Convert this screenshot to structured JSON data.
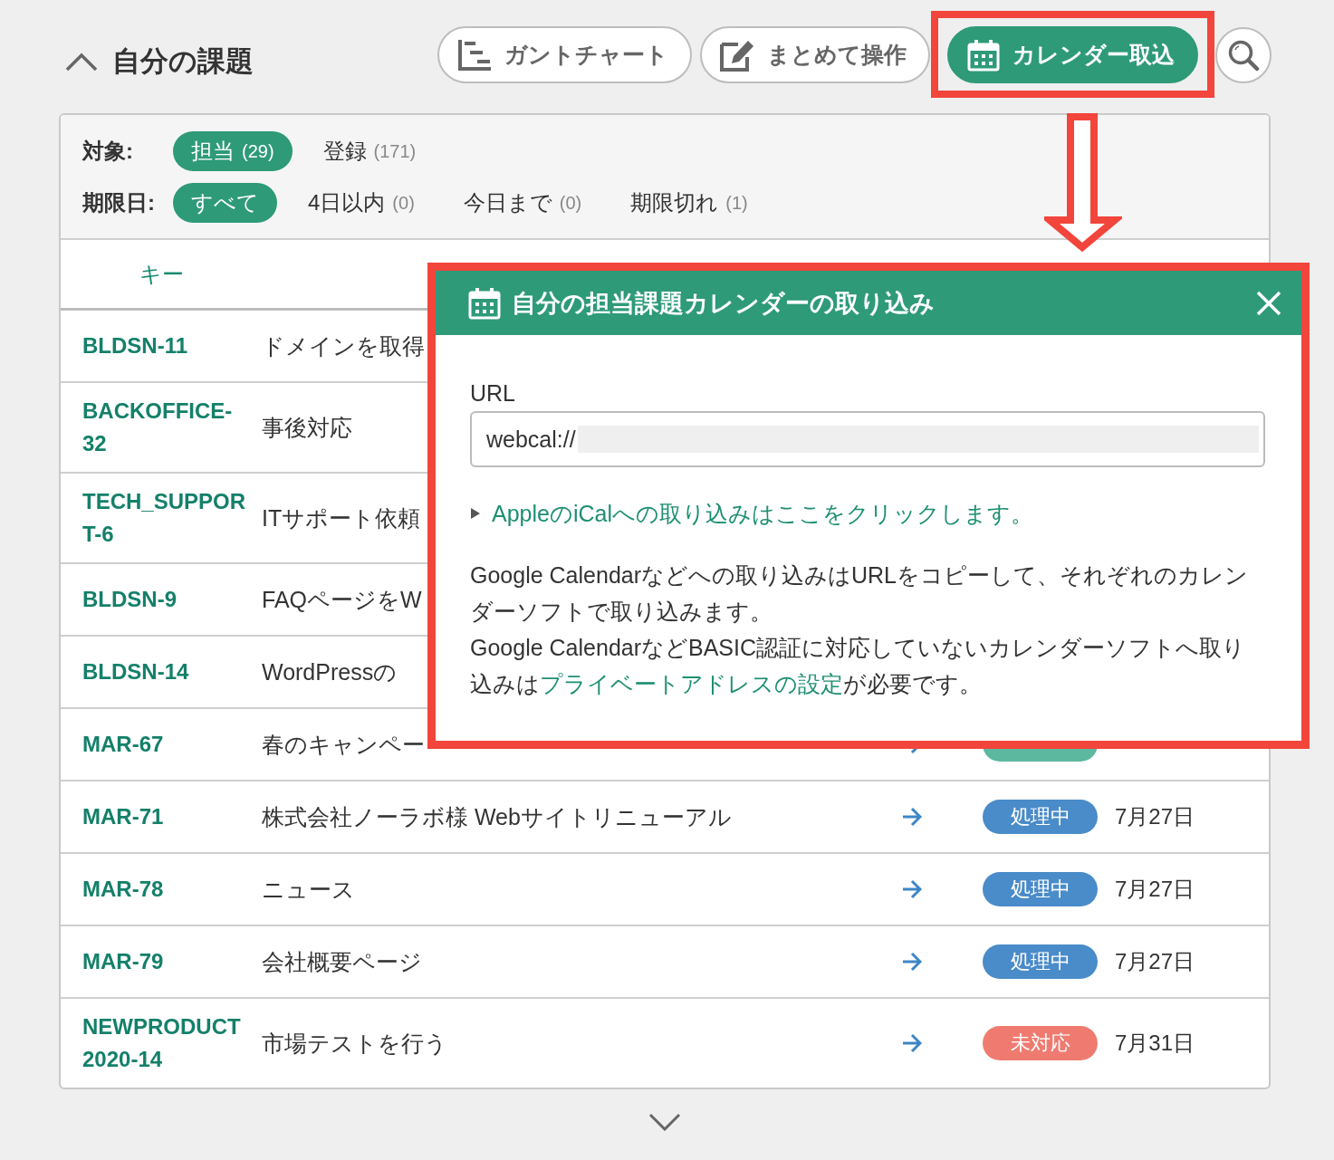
{
  "header": {
    "expanded": true,
    "title": "自分の課題"
  },
  "toolbar": [
    {
      "kind": "gantt",
      "label": "ガントチャート",
      "active": false,
      "highlighted": false
    },
    {
      "kind": "bulk_edit",
      "label": "まとめて操作",
      "active": false,
      "highlighted": false
    },
    {
      "kind": "calendar",
      "label": "カレンダー取込",
      "active": true,
      "highlighted": true
    },
    {
      "kind": "search",
      "active": false,
      "highlighted": false
    }
  ],
  "filters": [
    {
      "label": "対象:",
      "options": [
        {
          "label": "担当",
          "count": "(29)",
          "selected": true
        },
        {
          "label": "登録",
          "count": "(171)",
          "selected": false
        }
      ]
    },
    {
      "label": "期限日:",
      "options": [
        {
          "label": "すべて",
          "selected": true
        },
        {
          "label": "4日以内",
          "count": "(0)",
          "selected": false
        },
        {
          "label": "今日まで",
          "count": "(0)",
          "selected": false
        },
        {
          "label": "期限切れ",
          "count": "(1)",
          "selected": false
        }
      ]
    }
  ],
  "table": {
    "columns": [
      "キー"
    ],
    "rows": [
      {
        "key": "BLDSN-11",
        "summary": "ドメインを取得"
      },
      {
        "key": "BACKOFFICE-32",
        "summary": "事後対応"
      },
      {
        "key": "TECH_SUPPORT-6",
        "summary": "ITサポート依頼"
      },
      {
        "key": "BLDSN-9",
        "summary": "FAQページをW"
      },
      {
        "key": "BLDSN-14",
        "summary": "WordPressの"
      },
      {
        "key": "MAR-67",
        "summary": "春のキャンペー",
        "status": {
          "color": "#5cb89f"
        }
      },
      {
        "key": "MAR-71",
        "summary": "株式会社ノーラボ様 Webサイトリニューアル",
        "status": {
          "label": "処理中",
          "color": "#4a8bc9"
        },
        "due": "7月27日"
      },
      {
        "key": "MAR-78",
        "summary": "ニュース",
        "status": {
          "label": "処理中",
          "color": "#4a8bc9"
        },
        "due": "7月27日"
      },
      {
        "key": "MAR-79",
        "summary": "会社概要ページ",
        "status": {
          "label": "処理中",
          "color": "#4a8bc9"
        },
        "due": "7月27日"
      },
      {
        "key": "NEWPRODUCT2020-14",
        "summary": "市場テストを行う",
        "status": {
          "label": "未対応",
          "color": "#ef7b70"
        },
        "due": "7月31日"
      }
    ]
  },
  "dialog": {
    "highlighted": true,
    "title": "自分の担当課題カレンダーの取り込み",
    "url_label": "URL",
    "url_value": "webcal://",
    "url_masked": true,
    "ical_link": {
      "label": "AppleのiCalへの取り込みはここをクリックします。",
      "expanded": false
    },
    "paragraphs": [
      [
        {
          "kind": "text",
          "text": "Google Calendarなどへの取り込みはURLをコピーして、それぞれのカレンダーソフトで取り込みます。"
        }
      ],
      [
        {
          "kind": "text",
          "text": "Google CalendarなどBASIC認証に対応していないカレンダーソフトへ取り込みは"
        },
        {
          "kind": "link",
          "text": "プライベートアドレスの設定"
        },
        {
          "kind": "text",
          "text": "が必要です。"
        }
      ]
    ]
  },
  "callout_arrow": true
}
